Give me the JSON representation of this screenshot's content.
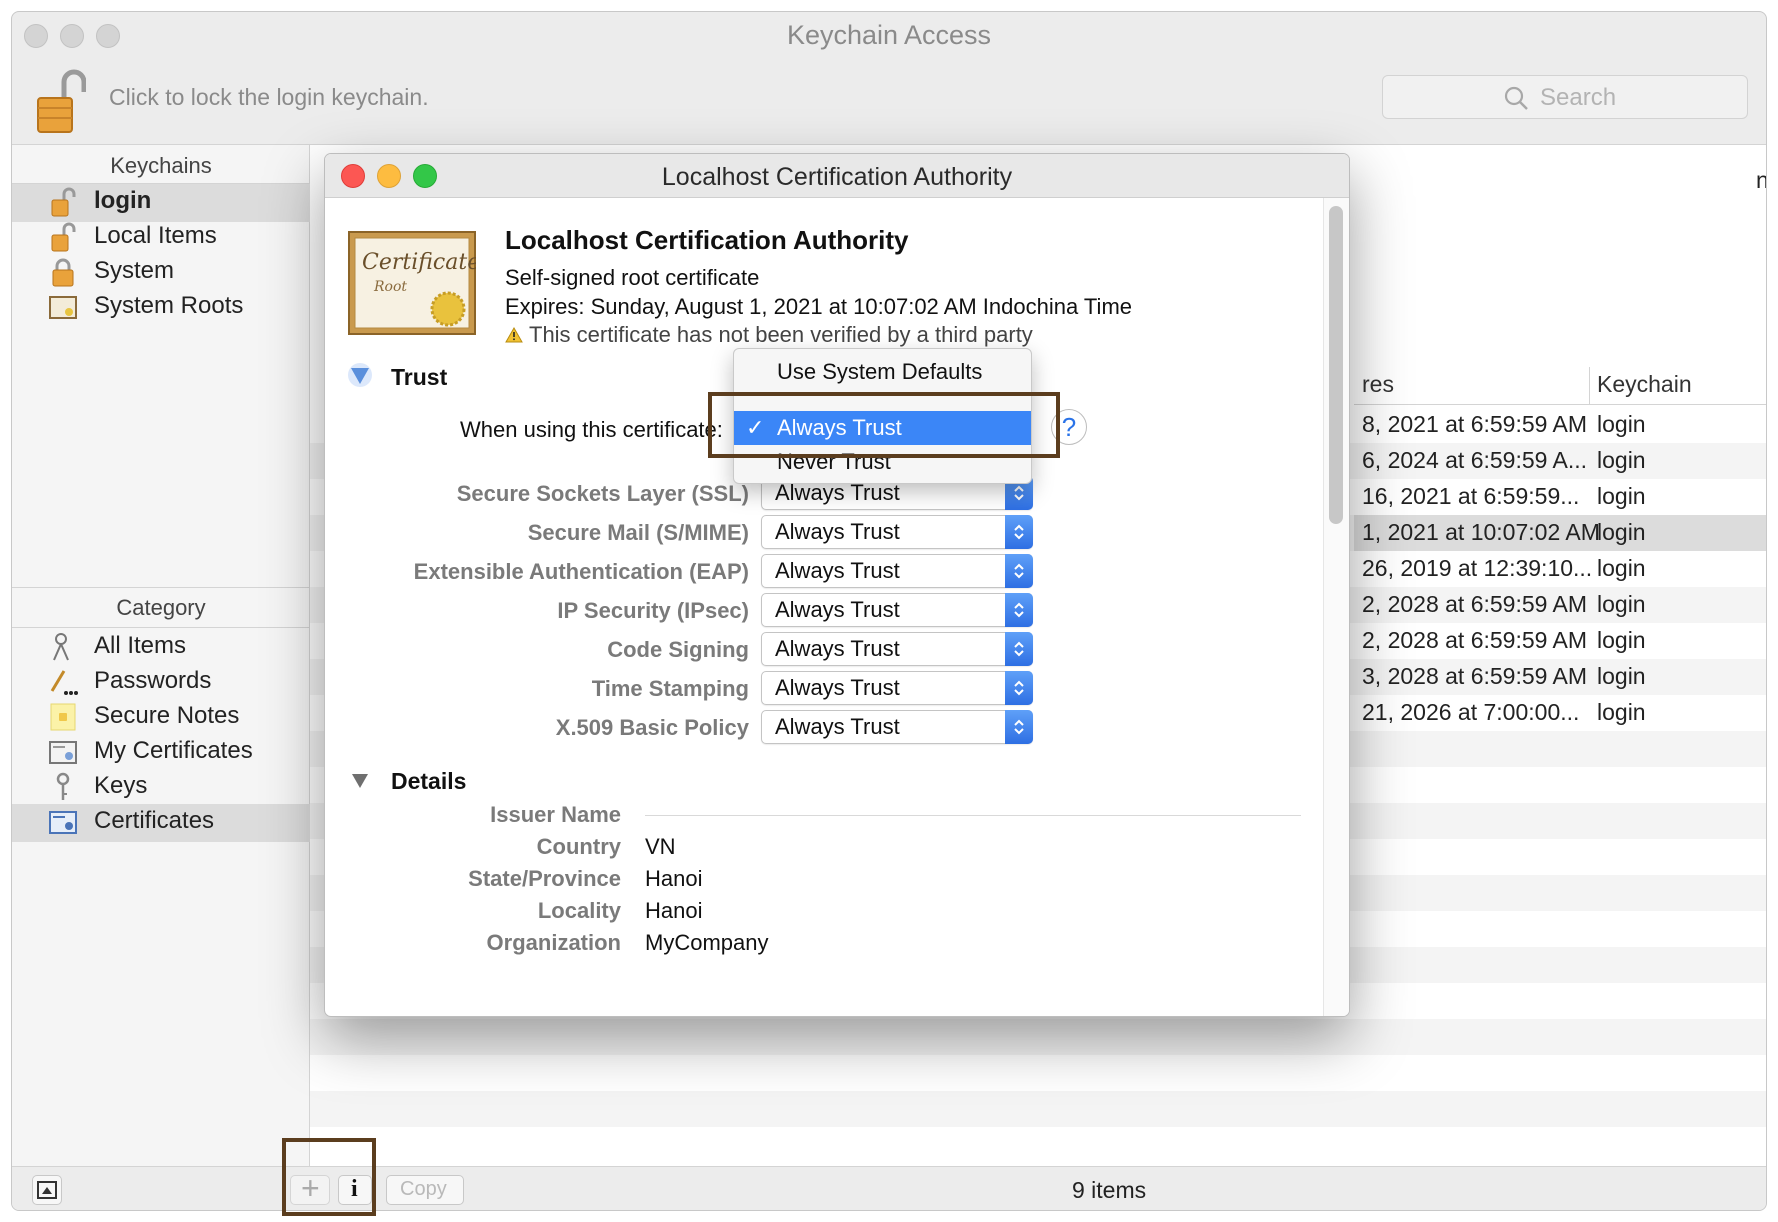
{
  "window": {
    "title": "Keychain Access",
    "lock_text": "Click to lock the login keychain.",
    "search_placeholder": "Search"
  },
  "sidebar": {
    "keychains_header": "Keychains",
    "keychains": [
      {
        "label": "login",
        "icon": "open-padlock-icon",
        "selected": true
      },
      {
        "label": "Local Items",
        "icon": "open-padlock-icon"
      },
      {
        "label": "System",
        "icon": "padlock-icon"
      },
      {
        "label": "System Roots",
        "icon": "certificate-icon"
      }
    ],
    "category_header": "Category",
    "categories": [
      {
        "label": "All Items",
        "icon": "all-items-icon"
      },
      {
        "label": "Passwords",
        "icon": "passwords-icon"
      },
      {
        "label": "Secure Notes",
        "icon": "secure-note-icon"
      },
      {
        "label": "My Certificates",
        "icon": "my-certificate-icon"
      },
      {
        "label": "Keys",
        "icon": "key-icon"
      },
      {
        "label": "Certificates",
        "icon": "certificate-icon",
        "selected": true
      }
    ]
  },
  "list": {
    "columns": [
      "res",
      "Keychain"
    ],
    "rows": [
      {
        "expires": "8, 2021 at 6:59:59 AM",
        "keychain": "login"
      },
      {
        "expires": "6, 2024 at 6:59:59 A...",
        "keychain": "login"
      },
      {
        "expires": "16, 2021 at 6:59:59...",
        "keychain": "login"
      },
      {
        "expires": "1, 2021 at 10:07:02 AM",
        "keychain": "login",
        "selected": true
      },
      {
        "expires": "26, 2019 at 12:39:10...",
        "keychain": "login"
      },
      {
        "expires": "2, 2028 at 6:59:59 AM",
        "keychain": "login"
      },
      {
        "expires": "2, 2028 at 6:59:59 AM",
        "keychain": "login"
      },
      {
        "expires": "3, 2028 at 6:59:59 AM",
        "keychain": "login"
      },
      {
        "expires": "21, 2026 at 7:00:00...",
        "keychain": "login"
      }
    ],
    "truncated_header_fragment": "n"
  },
  "bottom_bar": {
    "add_label": "+",
    "info_label": "i",
    "copy_label": "Copy",
    "item_count": "9 items"
  },
  "dialog": {
    "title": "Localhost Certification Authority",
    "cert_image_text": "Certificate",
    "cert_image_subtext": "Root",
    "cert_name": "Localhost Certification Authority",
    "cert_type": "Self-signed root certificate",
    "expires": "Expires: Sunday, August 1, 2021 at 10:07:02 AM Indochina Time",
    "warning": "This certificate has not been verified by a third party",
    "trust_section": "Trust",
    "when_using_label": "When using this certificate:",
    "help_label": "?",
    "trust_rows": [
      {
        "label": "Secure Sockets Layer (SSL)",
        "value": "Always Trust"
      },
      {
        "label": "Secure Mail (S/MIME)",
        "value": "Always Trust"
      },
      {
        "label": "Extensible Authentication (EAP)",
        "value": "Always Trust"
      },
      {
        "label": "IP Security (IPsec)",
        "value": "Always Trust"
      },
      {
        "label": "Code Signing",
        "value": "Always Trust"
      },
      {
        "label": "Time Stamping",
        "value": "Always Trust"
      },
      {
        "label": "X.509 Basic Policy",
        "value": "Always Trust"
      }
    ],
    "details_section": "Details",
    "details": [
      {
        "label": "Issuer Name",
        "value": ""
      },
      {
        "label": "Country",
        "value": "VN"
      },
      {
        "label": "State/Province",
        "value": "Hanoi"
      },
      {
        "label": "Locality",
        "value": "Hanoi"
      },
      {
        "label": "Organization",
        "value": "MyCompany"
      }
    ]
  },
  "dropdown_menu": {
    "options": [
      "Use System Defaults",
      "Always Trust",
      "Never Trust"
    ],
    "selected": "Always Trust",
    "check_mark": "✓"
  },
  "colors": {
    "accent_blue": "#3b86f7",
    "close_red": "#fc5753",
    "minimize_yellow": "#fdbc40",
    "zoom_green": "#33c748",
    "highlight_box": "#5b3d1e"
  }
}
